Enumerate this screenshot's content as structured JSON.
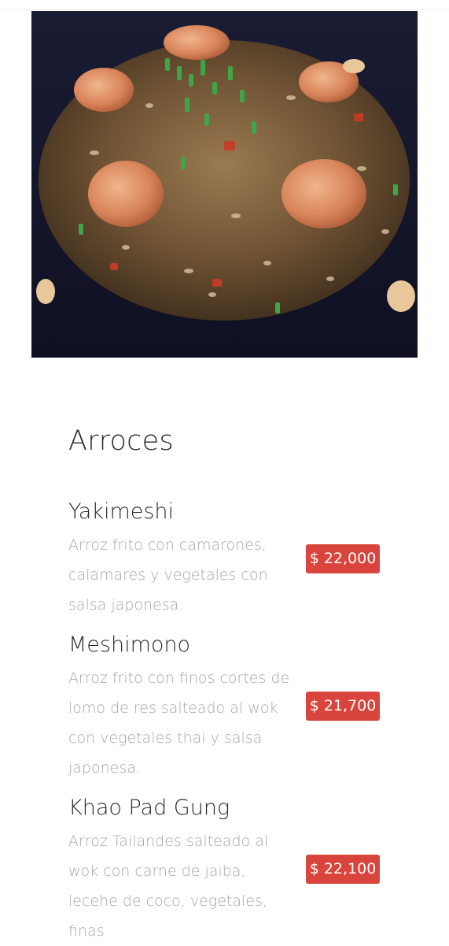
{
  "section": {
    "title": "Arroces"
  },
  "hero": {
    "image_name": "shrimp-fried-rice-photo"
  },
  "items": [
    {
      "name": "Yakimeshi",
      "description": "Arroz frito con camarones, calamares y vegetales con salsa japonesa.",
      "price": "$ 22,000"
    },
    {
      "name": "Meshimono",
      "description": "Arroz frito con finos cortes de lomo de res salteado al wok con vegetales thai y salsa japonesa.",
      "price": "$ 21,700"
    },
    {
      "name": "Khao Pad Gung",
      "description": "Arroz Tailandes salteado al wok con carne de jaiba, lecehe de coco, vegetales, finas",
      "price": "$ 22,100"
    }
  ],
  "colors": {
    "price_badge": "#d9453c",
    "title_text": "#2b2b2b",
    "description_text": "#a6a6a6",
    "hero_background": "#15172a"
  }
}
